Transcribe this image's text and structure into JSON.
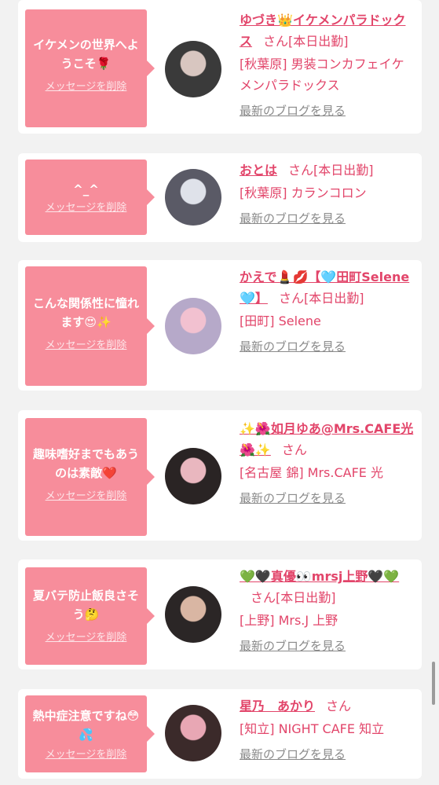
{
  "cards": [
    {
      "message": "イケメンの世界へようこそ🌹",
      "delete_label": "メッセージを削除",
      "name": "ゆづき👑イケメンパラドックス",
      "san": "さん",
      "status": "[本日出勤]",
      "shop": "[秋葉原] 男装コンカフェイケメンパラドックス",
      "blog_link": "最新のブログを見る",
      "avatar_colors": [
        "#3a3a3a",
        "#d8c6c0"
      ]
    },
    {
      "message": "^_^",
      "delete_label": "メッセージを削除",
      "name": "おとは",
      "san": "さん",
      "status": "[本日出勤]",
      "shop": "[秋葉原] カランコロン",
      "blog_link": "最新のブログを見る",
      "avatar_colors": [
        "#5a5a66",
        "#dfe2ea"
      ]
    },
    {
      "message": "こんな関係性に憧れます😍✨",
      "delete_label": "メッセージを削除",
      "name": "かえで💄💋【🩵田町Selene🩵】",
      "san": "さん",
      "status": "[本日出勤]",
      "shop": "[田町] Selene",
      "blog_link": "最新のブログを見る",
      "avatar_colors": [
        "#b6a9c9",
        "#f2c1d0"
      ]
    },
    {
      "message": "趣味嗜好までもあうのは素敵❤️",
      "delete_label": "メッセージを削除",
      "name": "✨🌺如月ゆあ@Mrs.CAFE光🌺✨",
      "san": "さん",
      "status": "",
      "shop": "[名古屋 錦] Mrs.CAFE 光",
      "blog_link": "最新のブログを見る",
      "avatar_colors": [
        "#2a2424",
        "#e9b7bf"
      ]
    },
    {
      "message": "夏バテ防止飯良さそう🤔",
      "delete_label": "メッセージを削除",
      "name": "💚🖤真優👀mrsj上野🖤💚",
      "san": "さん",
      "status": "[本日出勤]",
      "shop": "[上野] Mrs.J 上野",
      "blog_link": "最新のブログを見る",
      "avatar_colors": [
        "#2b2626",
        "#d9b6a3"
      ]
    },
    {
      "message": "熱中症注意ですね😳💦",
      "delete_label": "メッセージを削除",
      "name": "星乃　あかり",
      "san": "さん",
      "status": "",
      "shop": "[知立] NIGHT CAFE 知立",
      "blog_link": "最新のブログを見る",
      "avatar_colors": [
        "#3b2a2a",
        "#e8a7b4"
      ]
    }
  ]
}
